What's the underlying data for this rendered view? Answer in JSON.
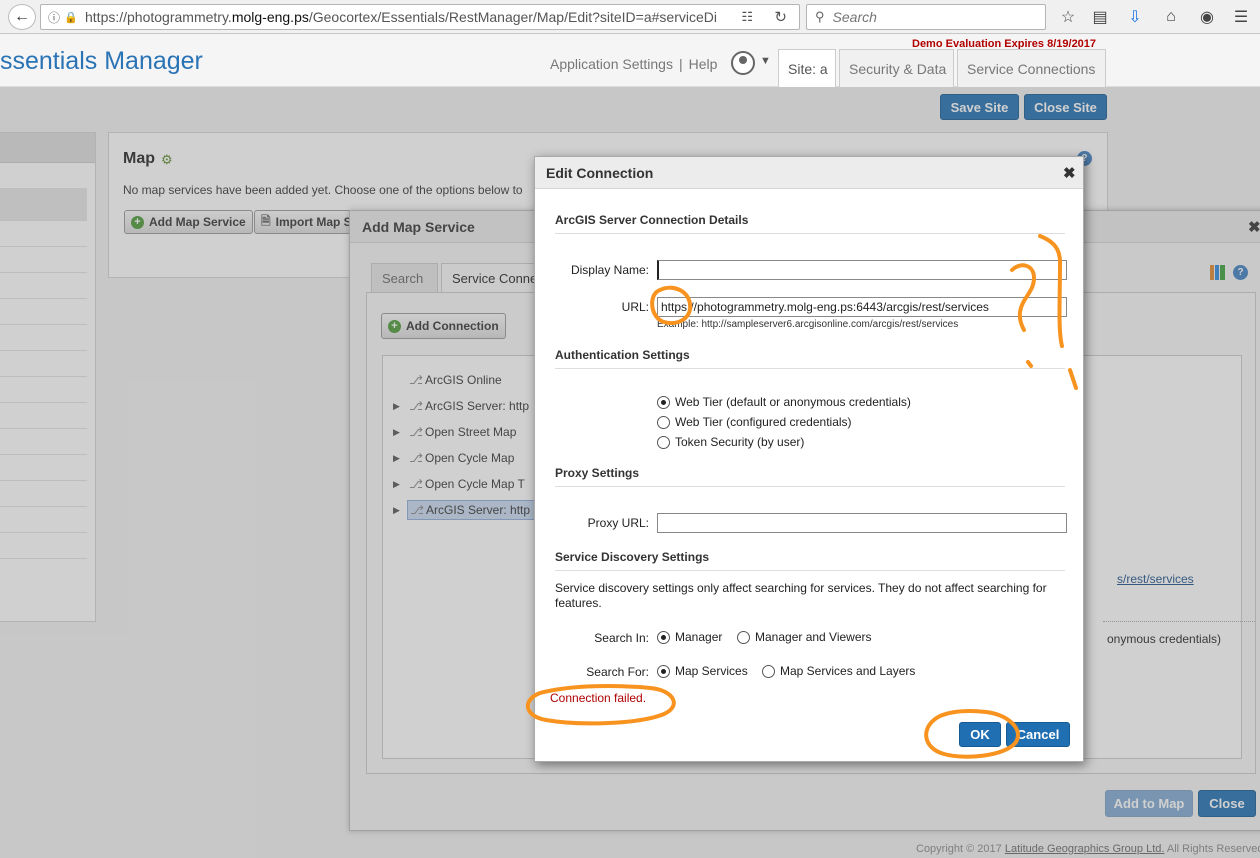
{
  "browser": {
    "url_pre": "https://photogrammetry.",
    "url_host": "molg-eng.ps",
    "url_post": "/Geocortex/Essentials/RestManager/Map/Edit?siteID=a#serviceDi",
    "search_placeholder": "Search"
  },
  "header": {
    "app_title": "ssentials Manager",
    "demo_notice": "Demo Evaluation Expires 8/19/2017",
    "link_app_settings": "Application Settings",
    "link_separator": "|",
    "link_help": "Help",
    "tabs": [
      {
        "label": "Site: a"
      },
      {
        "label": "Security & Data"
      },
      {
        "label": "Service Connections"
      }
    ],
    "save_site": "Save Site",
    "close_site": "Close Site"
  },
  "map_panel": {
    "title": "Map",
    "description": "No map services have been added yet. Choose one of the options below to",
    "add_map_service": "Add Map Service",
    "import_map": "Import Map S"
  },
  "add_map_service": {
    "title": "Add Map Service",
    "tabs": [
      {
        "label": "Search"
      },
      {
        "label": "Service Conne"
      }
    ],
    "add_connection": "Add Connection",
    "tree": [
      {
        "label": "ArcGIS Online",
        "expandable": false
      },
      {
        "label": "ArcGIS Server: http",
        "expandable": true
      },
      {
        "label": "Open Street Map",
        "expandable": true
      },
      {
        "label": "Open Cycle Map",
        "expandable": true
      },
      {
        "label": "Open Cycle Map T",
        "expandable": true
      },
      {
        "label": "ArcGIS Server: http",
        "expandable": true,
        "selected": true
      }
    ],
    "right_link": "s/rest/services",
    "right_text": "onymous credentials)",
    "add_to_map": "Add to Map",
    "close": "Close"
  },
  "edit_connection": {
    "title": "Edit Connection",
    "details_heading": "ArcGIS Server Connection Details",
    "display_name_label": "Display Name:",
    "display_name_value": "",
    "url_label": "URL:",
    "url_value": "https://photogrammetry.molg-eng.ps:6443/arcgis/rest/services",
    "url_example": "Example: http://sampleserver6.arcgisonline.com/arcgis/rest/services",
    "auth_heading": "Authentication Settings",
    "auth_options": [
      {
        "label": "Web Tier (default or anonymous credentials)",
        "selected": true
      },
      {
        "label": "Web Tier (configured credentials)",
        "selected": false
      },
      {
        "label": "Token Security (by user)",
        "selected": false
      }
    ],
    "proxy_heading": "Proxy Settings",
    "proxy_label": "Proxy URL:",
    "proxy_value": "",
    "discovery_heading": "Service Discovery Settings",
    "discovery_desc": "Service discovery settings only affect searching for services. They do not affect searching for features.",
    "search_in_label": "Search In:",
    "search_in_options": [
      {
        "label": "Manager",
        "selected": true
      },
      {
        "label": "Manager and Viewers",
        "selected": false
      }
    ],
    "search_for_label": "Search For:",
    "search_for_options": [
      {
        "label": "Map Services",
        "selected": true
      },
      {
        "label": "Map Services and Layers",
        "selected": false
      }
    ],
    "error": "Connection failed.",
    "ok": "OK",
    "cancel": "Cancel"
  },
  "footer": {
    "prefix": "Copyright © 2017 ",
    "company": "Latitude Geographics Group Ltd.",
    "suffix": " All Rights Reserved"
  },
  "colors": {
    "accent_blue": "#1f6fb2",
    "error_red": "#b00000",
    "annotation_orange": "#f7931e"
  }
}
